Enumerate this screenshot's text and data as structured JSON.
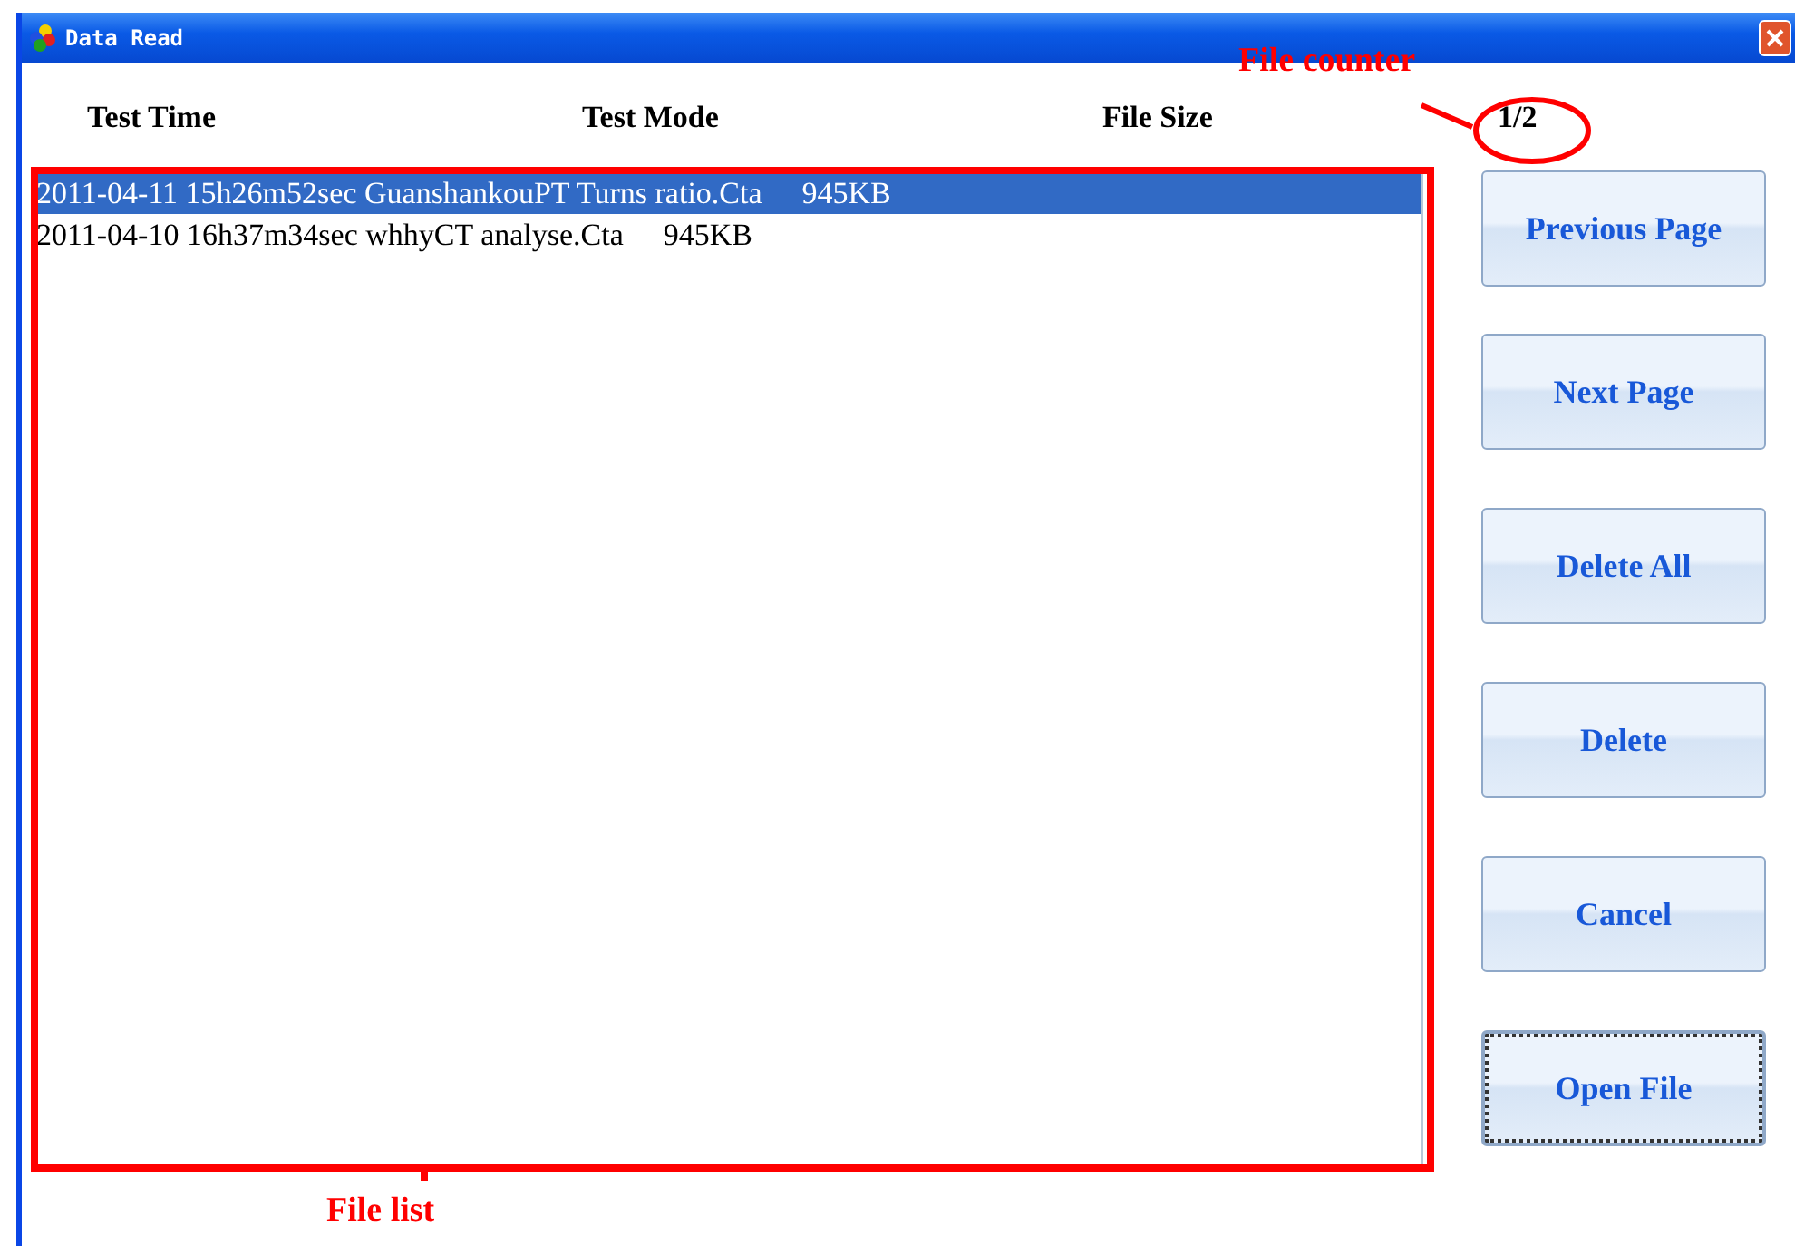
{
  "window": {
    "title": "Data Read"
  },
  "columns": [
    "Test Time",
    "Test Mode",
    "File Size"
  ],
  "file_counter": "1/2",
  "files": [
    {
      "name": "2011-04-11 15h26m52sec GuanshankouPT Turns ratio.Cta",
      "size": "945KB",
      "selected": true
    },
    {
      "name": "2011-04-10 16h37m34sec whhyCT analyse.Cta",
      "size": "945KB",
      "selected": false
    }
  ],
  "buttons": [
    {
      "label": "Previous Page",
      "focused": false
    },
    {
      "label": "Next Page",
      "focused": false
    },
    {
      "label": "Delete All",
      "focused": false
    },
    {
      "label": "Delete",
      "focused": false
    },
    {
      "label": "Cancel",
      "focused": false
    },
    {
      "label": "Open File",
      "focused": true
    }
  ],
  "annotations": {
    "file_counter": "File counter",
    "file_list": "File list"
  }
}
